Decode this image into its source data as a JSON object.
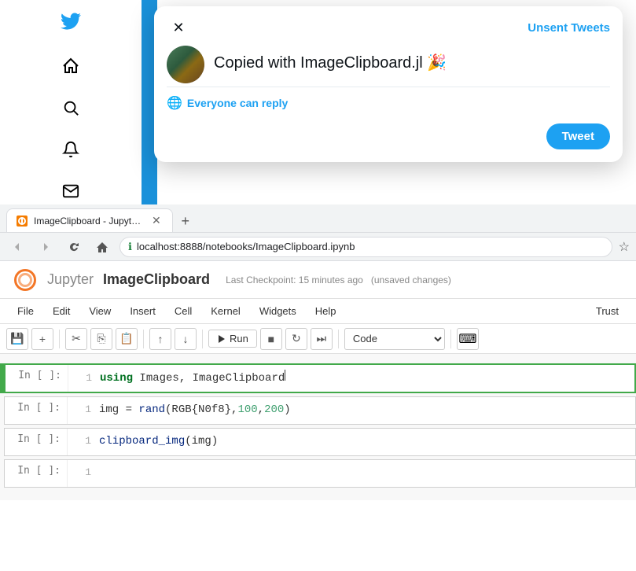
{
  "twitter": {
    "sidebar": {
      "bird_icon": "🐦",
      "home_icon": "⌂",
      "search_icon": "🔍",
      "bell_icon": "🔔",
      "mail_icon": "✉"
    },
    "modal": {
      "close_icon": "✕",
      "unsent_tweets_label": "Unsent Tweets",
      "tweet_text": "Copied with ImageClipboard.jl 🎉",
      "reply_setting": "Everyone can reply",
      "tweet_button_label": "Tweet"
    }
  },
  "browser": {
    "tab": {
      "label": "ImageClipboard - Jupyter No...",
      "close": "✕"
    },
    "new_tab_icon": "+",
    "nav": {
      "back": "←",
      "forward": "→",
      "refresh": "↻",
      "home": "⌂"
    },
    "url": "localhost:8888/notebooks/ImageClipboard.ipynb",
    "bookmark_icon": "☆"
  },
  "jupyter": {
    "logo_alt": "Jupyter",
    "app_name": "Jupyter",
    "notebook_name": "ImageClipboard",
    "checkpoint_text": "Last Checkpoint: 15 minutes ago",
    "unsaved_text": "(unsaved changes)",
    "menu": [
      "File",
      "Edit",
      "View",
      "Insert",
      "Cell",
      "Kernel",
      "Widgets",
      "Help"
    ],
    "toolbar": {
      "save_icon": "💾",
      "add_icon": "+",
      "cut_icon": "✂",
      "copy_icon": "⎘",
      "paste_icon": "📋",
      "move_up_icon": "↑",
      "move_down_icon": "↓",
      "run_label": "Run",
      "stop_icon": "■",
      "restart_icon": "↻",
      "fast_forward_icon": "⏭",
      "cell_type": "Code",
      "keyboard_icon": "⌨"
    },
    "trust_label": "Trust",
    "cells": [
      {
        "prompt": "In [ ]:",
        "line_num": "1",
        "code_parts": [
          {
            "type": "keyword",
            "text": "using"
          },
          {
            "type": "normal",
            "text": " Images, ImageClipboard"
          }
        ],
        "raw_code": "using Images, ImageClipboard",
        "active": true
      },
      {
        "prompt": "In [ ]:",
        "line_num": "1",
        "raw_code": "img = rand(RGB{N0f8},100,200)",
        "active": false
      },
      {
        "prompt": "In [ ]:",
        "line_num": "1",
        "raw_code": "clipboard_img(img)",
        "active": false
      },
      {
        "prompt": "In [ ]:",
        "line_num": "1",
        "raw_code": "",
        "active": false
      }
    ]
  }
}
